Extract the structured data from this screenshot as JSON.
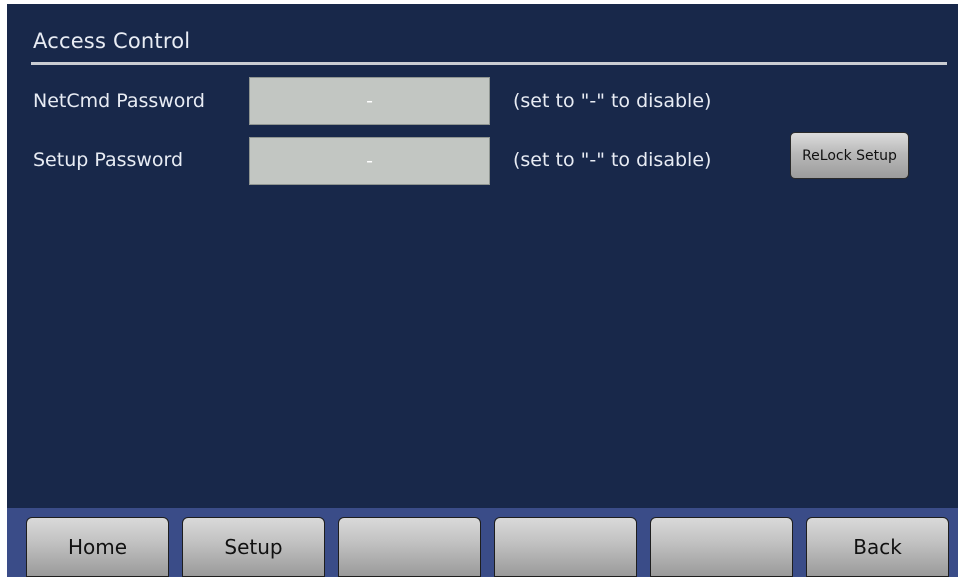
{
  "page": {
    "title": "Access Control"
  },
  "rows": [
    {
      "label": "NetCmd Password",
      "value": "-",
      "hint": "(set to \"-\" to disable)"
    },
    {
      "label": "Setup Password",
      "value": "-",
      "hint": "(set to \"-\" to disable)"
    }
  ],
  "relock_button": {
    "label": "ReLock Setup"
  },
  "bottom_buttons": [
    {
      "label": "Home"
    },
    {
      "label": "Setup"
    },
    {
      "label": ""
    },
    {
      "label": ""
    },
    {
      "label": ""
    },
    {
      "label": "Back"
    }
  ],
  "colors": {
    "background": "#18284a",
    "field": "#c2c6c2",
    "bottom_bar": "#3a4c88",
    "button": "#c3c3c3"
  }
}
